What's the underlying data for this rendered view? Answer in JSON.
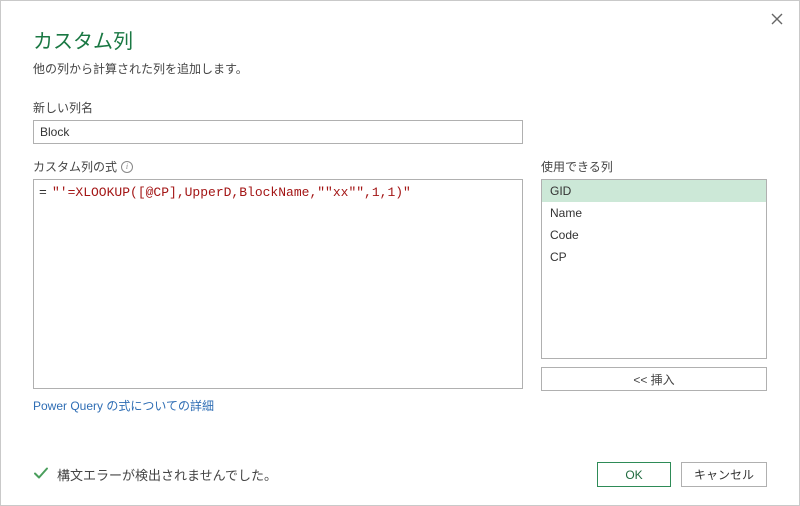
{
  "title": "カスタム列",
  "subtitle": "他の列から計算された列を追加します。",
  "new_column_label": "新しい列名",
  "new_column_value": "Block",
  "formula_label": "カスタム列の式",
  "formula_prefix": "=",
  "formula_body": "\"'=XLOOKUP([@CP],UpperD,BlockName,\"\"xx\"\",1,1)\"",
  "available_label": "使用できる列",
  "available_columns": [
    "GID",
    "Name",
    "Code",
    "CP"
  ],
  "selected_column_index": 0,
  "insert_label": "<< 挿入",
  "link_text": "Power Query の式についての詳細",
  "status_text": "構文エラーが検出されませんでした。",
  "ok_label": "OK",
  "cancel_label": "キャンセル"
}
